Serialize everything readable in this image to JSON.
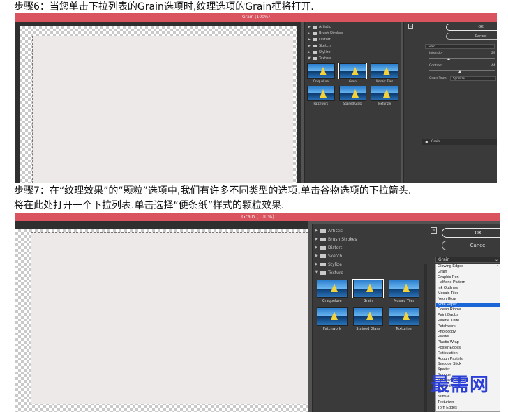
{
  "steps": {
    "step6": "步骤6：当您单击下拉列表的Grain选项时,纹理选项的Grain框将打开.",
    "step7_line1": "步骤7：在“纹理效果”的“颗粒”选项中,我们有许多不同类型的选项.单击谷物选项的下拉箭头.",
    "step7_line2": "将在此处打开一个下拉列表.单击选择“便条纸”样式的颗粒效果."
  },
  "screenshot1": {
    "title": "Grain (100%)",
    "categories": [
      "Artistic",
      "Brush Strokes",
      "Distort",
      "Sketch",
      "Stylize",
      "Texture"
    ],
    "thumbs": [
      "Craquelure",
      "Grain",
      "Mosaic Tiles",
      "Patchwork",
      "Stained Glass",
      "Texturizer"
    ],
    "ok": "OK",
    "cancel": "Cancel",
    "mini": "≡",
    "filter_select": "Grain",
    "intensity_label": "Intensity",
    "intensity_value": "29",
    "contrast_label": "Contrast",
    "contrast_value": "44",
    "grain_type_label": "Grain Type:",
    "grain_type_value": "Sprinkles",
    "layer_name": "Grain"
  },
  "screenshot2": {
    "title": "Grain (100%)",
    "categories": [
      "Artistic",
      "Brush Strokes",
      "Distort",
      "Sketch",
      "Stylize",
      "Texture"
    ],
    "thumbs": [
      "Craquelure",
      "Grain",
      "Mosaic Tiles",
      "Patchwork",
      "Stained Glass",
      "Texturizer"
    ],
    "ok": "OK",
    "cancel": "Cancel",
    "mini": "≡",
    "filter_select": "Grain",
    "dropdown_items": [
      "Glowing Edges",
      "Grain",
      "Graphic Pen",
      "Halftone Pattern",
      "Ink Outlines",
      "Mosaic Tiles",
      "Neon Glow",
      "Note Paper",
      "Ocean Ripple",
      "Paint Daubs",
      "Palette Knife",
      "Patchwork",
      "Photocopy",
      "Plaster",
      "Plastic Wrap",
      "Poster Edges",
      "Reticulation",
      "Rough Pastels",
      "Smudge Stick",
      "Spatter",
      "Sponge",
      "Sprayed Strokes",
      "Stained Glass",
      "Stamp",
      "Sumi-e",
      "Texturizer",
      "Torn Edges"
    ],
    "highlighted_item": "Note Paper"
  },
  "watermark": "最需网",
  "colors": {
    "titlebar": "#d9545f",
    "panel": "#3a3a3a",
    "highlight": "#1a66d6",
    "watermark": "#2b3fd8"
  }
}
